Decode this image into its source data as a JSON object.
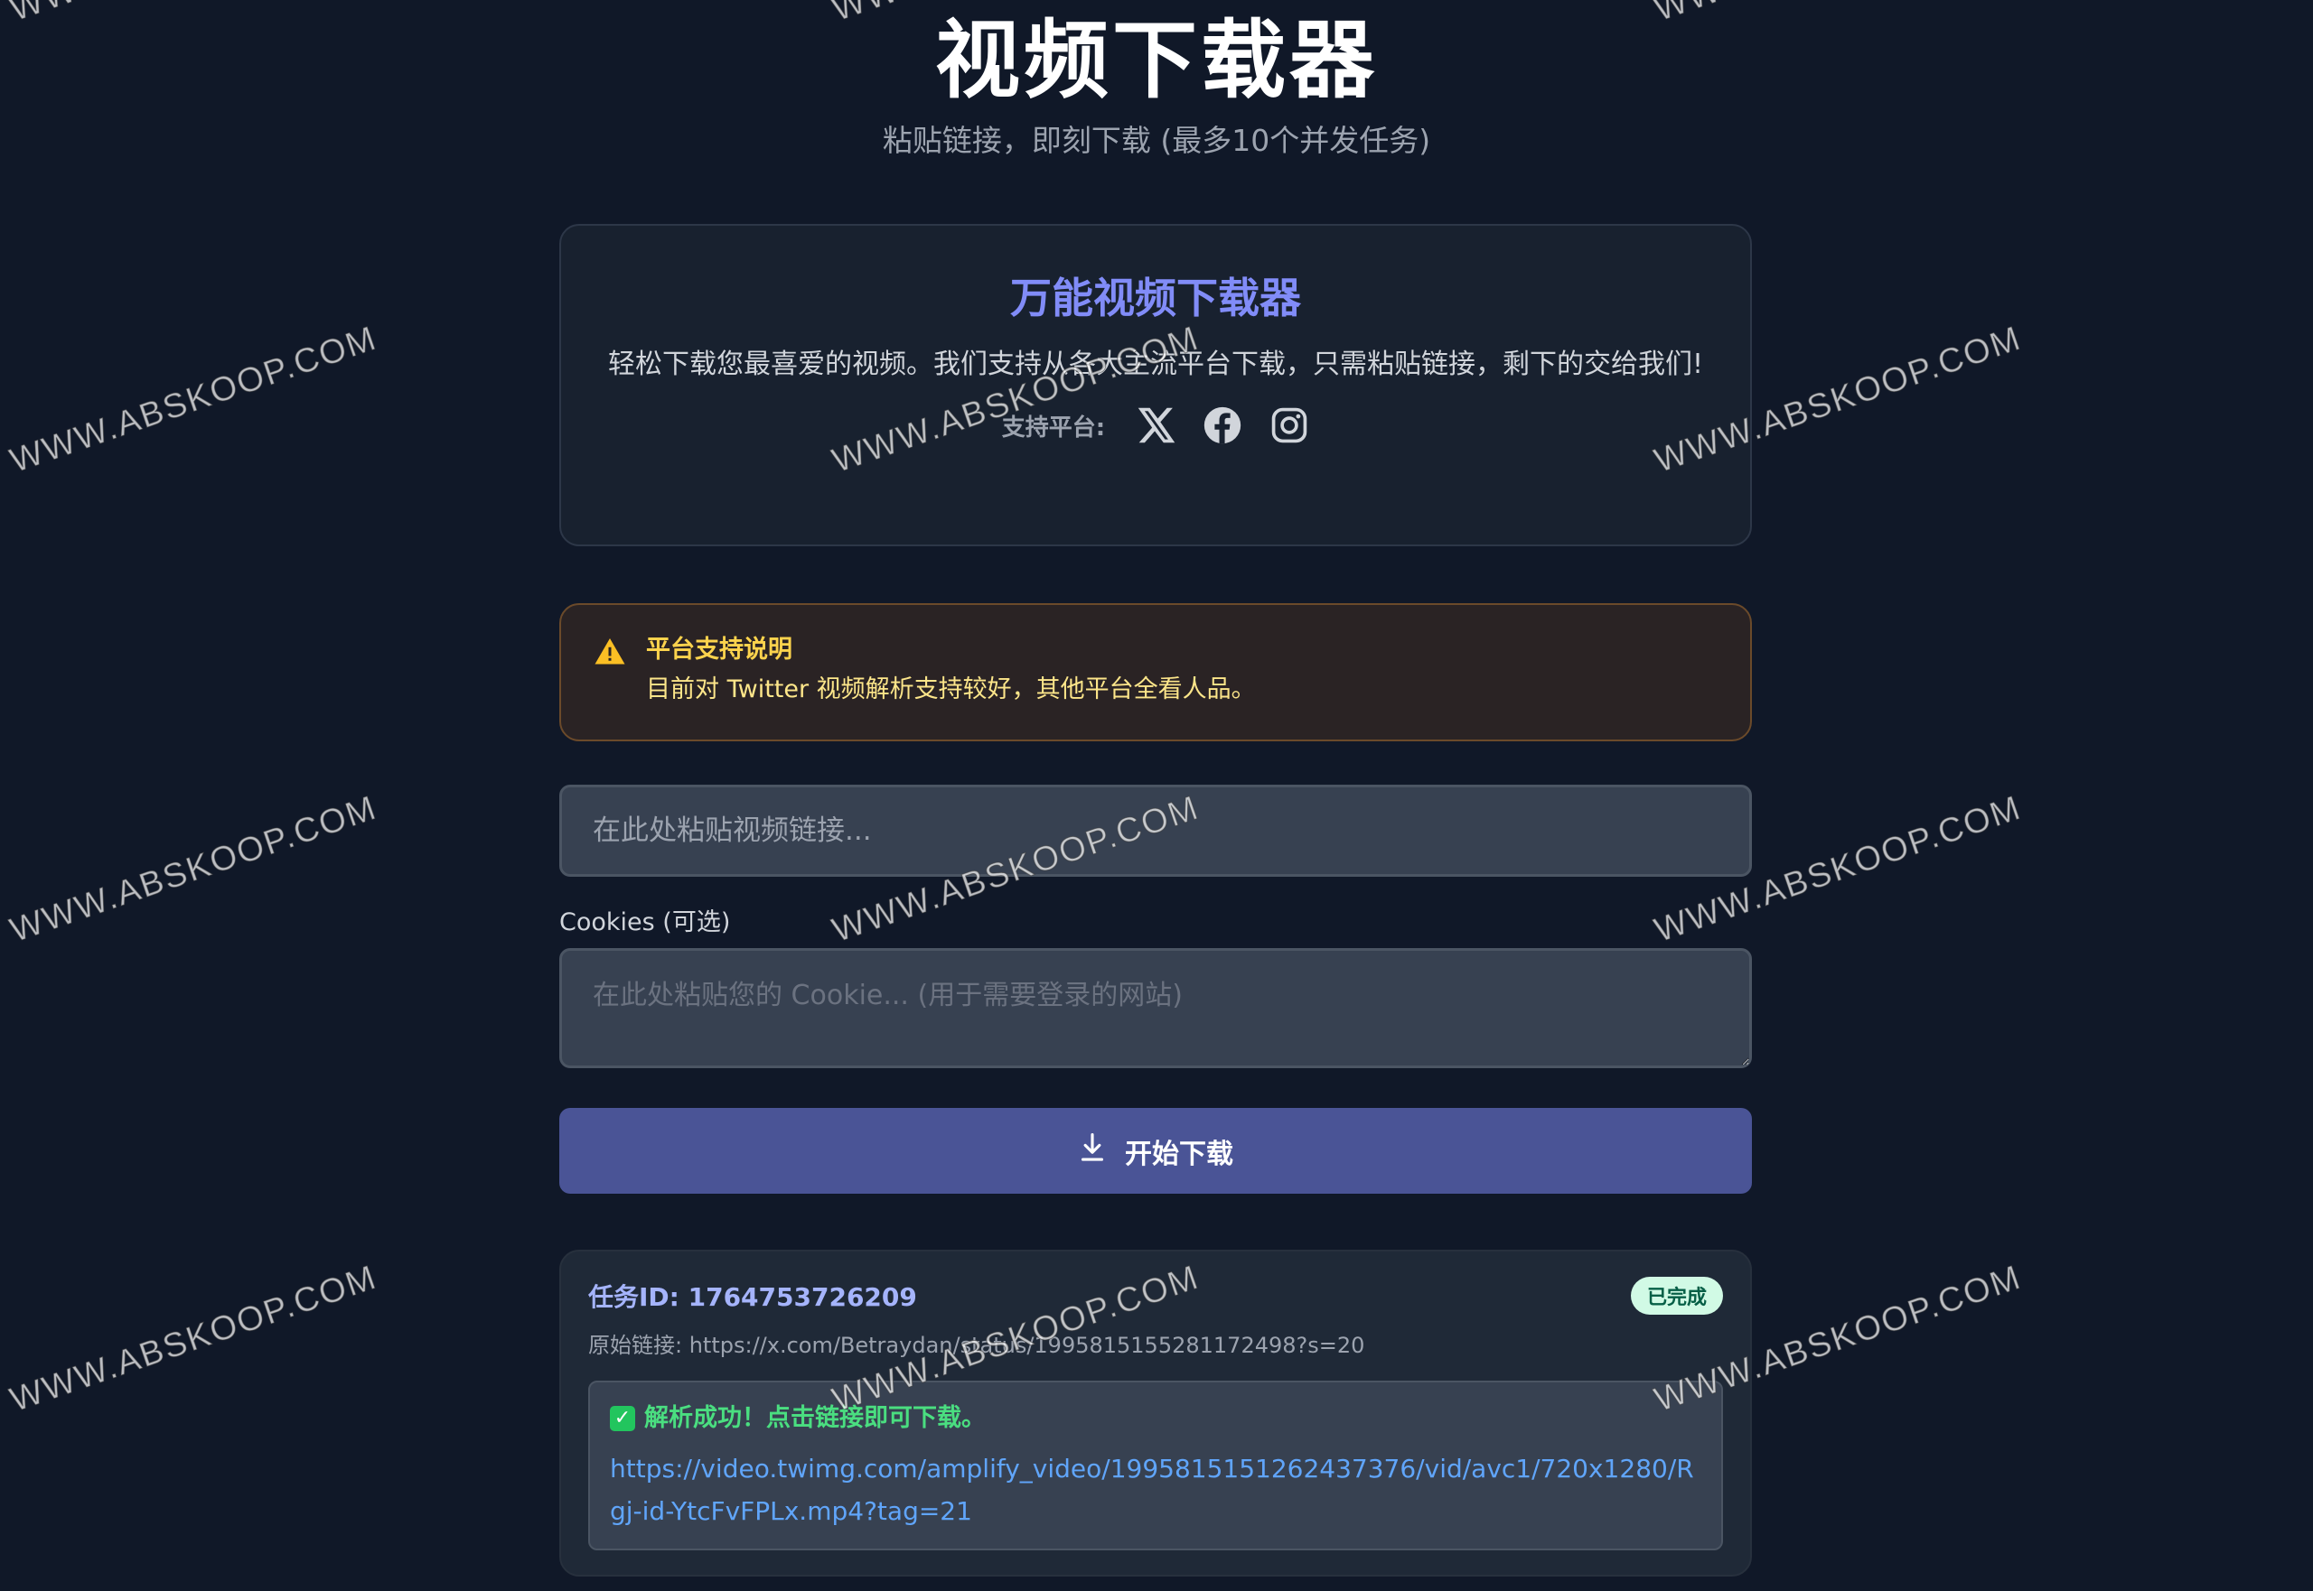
{
  "header": {
    "title": "视频下载器",
    "subtitle": "粘贴链接，即刻下载 (最多10个并发任务)"
  },
  "intro": {
    "title": "万能视频下载器",
    "description": "轻松下载您最喜爱的视频。我们支持从各大主流平台下载，只需粘贴链接，剩下的交给我们!",
    "platforms_label": "支持平台:",
    "platforms": [
      "x-icon",
      "facebook-icon",
      "instagram-icon"
    ]
  },
  "notice": {
    "icon": "warning-icon",
    "title": "平台支持说明",
    "body": "目前对 Twitter 视频解析支持较好，其他平台全看人品。"
  },
  "form": {
    "url_placeholder": "在此处粘贴视频链接...",
    "cookies_label": "Cookies (可选)",
    "cookies_placeholder": "在此处粘贴您的 Cookie... (用于需要登录的网站)",
    "submit_label": "开始下载"
  },
  "task": {
    "id_label": "任务ID: 1764753726209",
    "status": "已完成",
    "source": "原始链接: https://x.com/Betraydan/status/1995815155281172498?s=20",
    "result_status": "解析成功！点击链接即可下载。",
    "result_link": "https://video.twimg.com/amplify_video/1995815151262437376/vid/avc1/720x1280/Rgj-id-YtcFvFPLx.mp4?tag=21"
  },
  "watermark": "WWW.ABSKOOP.COM",
  "colors": {
    "background": "#101828",
    "accent": "#818cf8",
    "button": "#4a5496",
    "warning": "#fcd34d",
    "success": "#4ade80",
    "link": "#60a5fa"
  }
}
